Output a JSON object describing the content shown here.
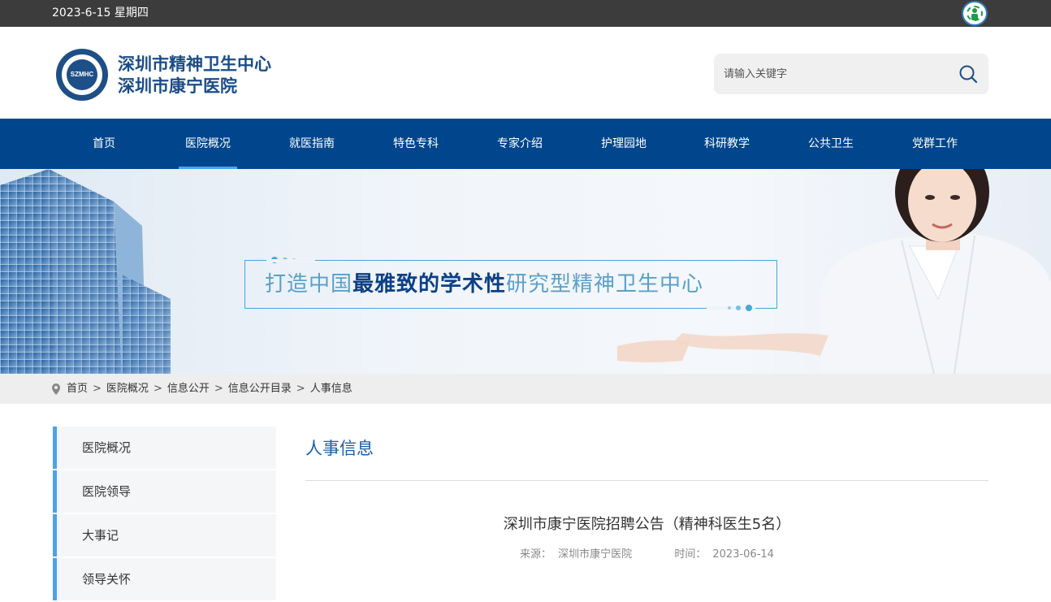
{
  "topbar": {
    "date": "2023-6-15 星期四",
    "accessibility_icon": "accessibility-icon"
  },
  "header": {
    "logo_text": "SZMHC",
    "org_name_line1": "深圳市精神卫生中心",
    "org_name_line2": "深圳市康宁医院",
    "search_placeholder": "请输入关键字",
    "search_icon": "search-icon"
  },
  "nav": {
    "items": [
      {
        "label": "首页"
      },
      {
        "label": "医院概况"
      },
      {
        "label": "就医指南"
      },
      {
        "label": "特色专科"
      },
      {
        "label": "专家介绍"
      },
      {
        "label": "护理园地"
      },
      {
        "label": "科研教学"
      },
      {
        "label": "公共卫生"
      },
      {
        "label": "党群工作"
      }
    ],
    "active": "医院概况"
  },
  "banner": {
    "slogan_prefix": "打造中国",
    "slogan_emphasis": "最雅致的学术性",
    "slogan_suffix": "研究型精神卫生中心"
  },
  "breadcrumb": {
    "items": [
      "首页",
      "医院概况",
      "信息公开",
      "信息公开目录",
      "人事信息"
    ],
    "separator": ">"
  },
  "sidebar": {
    "items": [
      {
        "label": "医院概况"
      },
      {
        "label": "医院领导"
      },
      {
        "label": "大事记"
      },
      {
        "label": "领导关怀"
      }
    ]
  },
  "content": {
    "section_title": "人事信息",
    "article_title": "深圳市康宁医院招聘公告（精神科医生5名）",
    "source_label": "来源：",
    "source_value": "深圳市康宁医院",
    "time_label": "时间：",
    "time_value": "2023-06-14"
  },
  "colors": {
    "nav_bg": "#01468c",
    "topbar_bg": "#3c3c3c",
    "accent": "#4aa3ea",
    "title_blue": "#1b5fa6"
  }
}
